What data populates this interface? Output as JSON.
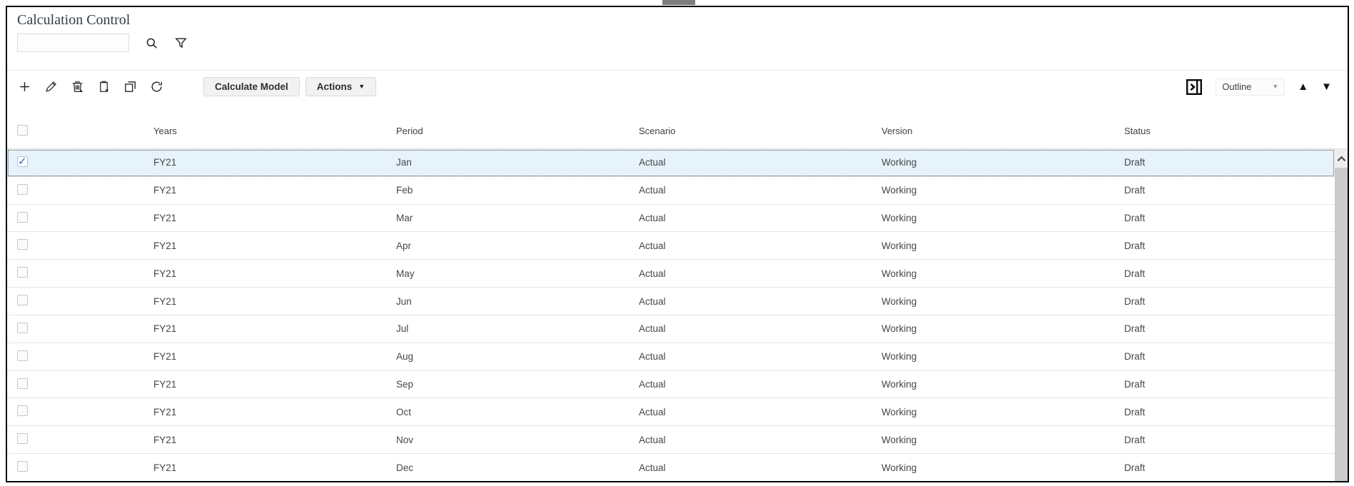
{
  "window": {
    "title": "Calculation Control"
  },
  "search": {
    "value": "",
    "placeholder": ""
  },
  "toolbar": {
    "icon_buttons": [
      "add",
      "edit",
      "delete",
      "paste",
      "duplicate",
      "refresh"
    ],
    "calculate_model_label": "Calculate Model",
    "actions_label": "Actions",
    "view_dropdown": {
      "value": "Outline"
    }
  },
  "icons": {
    "actions_caret": "▼",
    "dropdown_caret": "▼",
    "move_up": "▲",
    "move_down": "▼"
  },
  "table": {
    "columns": [
      "Years",
      "Period",
      "Scenario",
      "Version",
      "Status"
    ],
    "rows": [
      {
        "years": "FY21",
        "period": "Jan",
        "scenario": "Actual",
        "version": "Working",
        "status": "Draft",
        "selected": true,
        "checked": true
      },
      {
        "years": "FY21",
        "period": "Feb",
        "scenario": "Actual",
        "version": "Working",
        "status": "Draft",
        "selected": false,
        "checked": false
      },
      {
        "years": "FY21",
        "period": "Mar",
        "scenario": "Actual",
        "version": "Working",
        "status": "Draft",
        "selected": false,
        "checked": false
      },
      {
        "years": "FY21",
        "period": "Apr",
        "scenario": "Actual",
        "version": "Working",
        "status": "Draft",
        "selected": false,
        "checked": false
      },
      {
        "years": "FY21",
        "period": "May",
        "scenario": "Actual",
        "version": "Working",
        "status": "Draft",
        "selected": false,
        "checked": false
      },
      {
        "years": "FY21",
        "period": "Jun",
        "scenario": "Actual",
        "version": "Working",
        "status": "Draft",
        "selected": false,
        "checked": false
      },
      {
        "years": "FY21",
        "period": "Jul",
        "scenario": "Actual",
        "version": "Working",
        "status": "Draft",
        "selected": false,
        "checked": false
      },
      {
        "years": "FY21",
        "period": "Aug",
        "scenario": "Actual",
        "version": "Working",
        "status": "Draft",
        "selected": false,
        "checked": false
      },
      {
        "years": "FY21",
        "period": "Sep",
        "scenario": "Actual",
        "version": "Working",
        "status": "Draft",
        "selected": false,
        "checked": false
      },
      {
        "years": "FY21",
        "period": "Oct",
        "scenario": "Actual",
        "version": "Working",
        "status": "Draft",
        "selected": false,
        "checked": false
      },
      {
        "years": "FY21",
        "period": "Nov",
        "scenario": "Actual",
        "version": "Working",
        "status": "Draft",
        "selected": false,
        "checked": false
      },
      {
        "years": "FY21",
        "period": "Dec",
        "scenario": "Actual",
        "version": "Working",
        "status": "Draft",
        "selected": false,
        "checked": false
      }
    ]
  },
  "colors": {
    "frame_border": "#000000",
    "title_text": "#313d49",
    "body_text": "#44474b",
    "selected_row_bg": "#e7f3fa",
    "row_divider": "#e5e5e5",
    "button_bg": "#f2f2f2",
    "button_border": "#dadada",
    "button_text": "#312d2a",
    "checkbox_check": "#1d6ec2",
    "scrollbar_track": "#cbcbcb",
    "scrollbar_button_bg": "#ededed"
  }
}
